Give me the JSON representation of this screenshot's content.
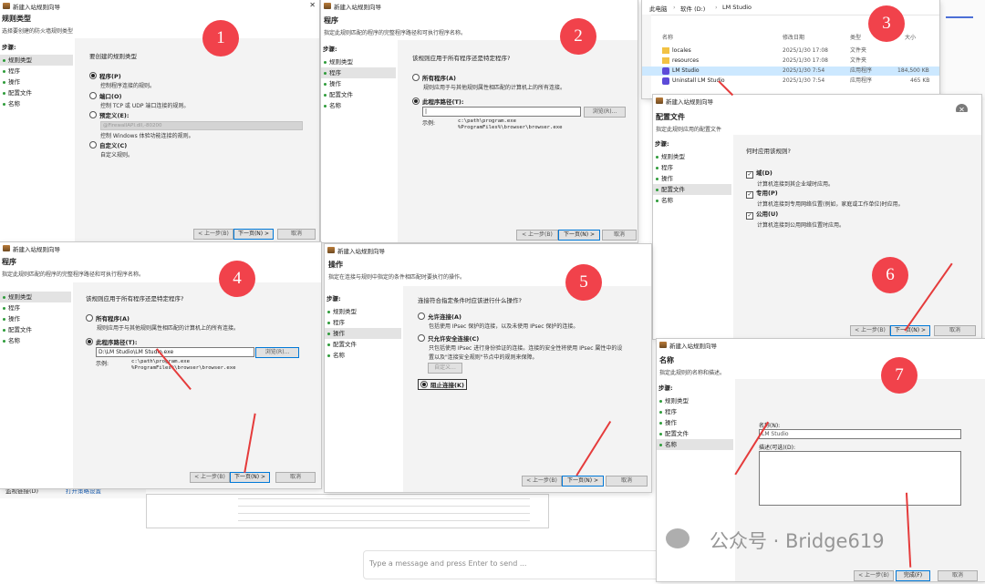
{
  "common": {
    "wizard_title": "新建入站规则向导",
    "close": "✕",
    "steps_label": "步骤:",
    "steps": [
      "规则类型",
      "程序",
      "操作",
      "配置文件",
      "名称"
    ],
    "btn_back": "< 上一步(B)",
    "btn_next": "下一页(N) >",
    "btn_cancel": "取消",
    "btn_finish": "完成(F)"
  },
  "p1": {
    "num": "1",
    "heading": "规则类型",
    "sub": "选择要创建的防火墙规则类型",
    "question": "要创建的规则类型",
    "opts": [
      {
        "label": "程序(P)",
        "desc": "控制程序连接的规则。"
      },
      {
        "label": "端口(O)",
        "desc": "控制 TCP 或 UDP 端口连接的规则。"
      },
      {
        "label": "预定义(E):",
        "desc": "控制 Windows 体验功能连接的规则。"
      },
      {
        "label": "自定义(C)",
        "desc": "自定义规则。"
      }
    ],
    "predefined_value": "@FirewallAPI.dll,-80200"
  },
  "p2": {
    "num": "2",
    "heading": "程序",
    "sub": "指定此规则匹配的程序的完整程序路径和可执行程序名称。",
    "question": "该规则应用于所有程序还是特定程序?",
    "all_label": "所有程序(A)",
    "all_desc": "规则应用于与其他规则属性相匹配的计算机上的所有连接。",
    "path_label": "此程序路径(T):",
    "browse": "浏览(R)...",
    "example_label": "示例:",
    "example_1": "c:\\path\\program.exe",
    "example_2": "%ProgramFiles%\\browser\\browser.exe"
  },
  "p3": {
    "num": "3",
    "breadcrumb": [
      "此电脑",
      "软件 (D:)",
      "LM Studio"
    ],
    "cols": [
      "名称",
      "修改日期",
      "类型",
      "大小"
    ],
    "rows": [
      {
        "name": "locales",
        "date": "2025/1/30 17:08",
        "type": "文件夹",
        "size": ""
      },
      {
        "name": "resources",
        "date": "2025/1/30 17:08",
        "type": "文件夹",
        "size": ""
      },
      {
        "name": "LM Studio",
        "date": "2025/1/30 7:54",
        "type": "应用程序",
        "size": "184,500 KB"
      },
      {
        "name": "Uninstall LM Studio",
        "date": "2025/1/30 7:54",
        "type": "应用程序",
        "size": "465 KB"
      }
    ]
  },
  "p4": {
    "num": "4",
    "heading": "程序",
    "sub": "指定此规则匹配的程序的完整程序路径和可执行程序名称。",
    "path_value": "D:\\LM Studio\\LM Studio.exe"
  },
  "p5": {
    "num": "5",
    "heading": "操作",
    "sub": "指定在连接与规则中指定的条件相匹配时要执行的操作。",
    "question": "连接符合指定条件时应该进行什么操作?",
    "allow_label": "允许连接(A)",
    "allow_desc": "包括使用 IPsec 保护的连接，以及未使用 IPsec 保护的连接。",
    "secure_label": "只允许安全连接(C)",
    "secure_desc_1": "只包括使用 IPsec 进行身份验证的连接。连接的安全性将使用 IPsec 属性中的设",
    "secure_desc_2": "置以及\"连接安全规则\"节点中的规则来保障。",
    "custom_btn": "自定义...",
    "block_label": "阻止连接(K)"
  },
  "p6": {
    "num": "6",
    "heading": "配置文件",
    "sub": "指定此规则应用的配置文件",
    "question": "何时应用该规则?",
    "opts": [
      {
        "label": "域(D)",
        "desc": "计算机连接到其企业域时应用。"
      },
      {
        "label": "专用(P)",
        "desc": "计算机连接到专用网络位置(例如，家庭或工作单位)时应用。"
      },
      {
        "label": "公用(U)",
        "desc": "计算机连接到公用网络位置时应用。"
      }
    ]
  },
  "p7": {
    "num": "7",
    "heading": "名称",
    "sub": "指定此规则的名称和描述。",
    "name_label": "名称(N):",
    "name_value": "LM Studio",
    "desc_label": "描述(可选)(D):"
  },
  "background": {
    "fw_link_1": "监视链接(D)",
    "fw_link_2": "打开策略设置",
    "chat_placeholder": "Type a message and press Enter to send ...",
    "watermark": "公众号 · Bridge619"
  },
  "colors": {
    "badge": "#f1424b",
    "arrow": "#e53b3b",
    "step_dot": "#2e9b3a",
    "selected_row": "#cce8ff"
  }
}
